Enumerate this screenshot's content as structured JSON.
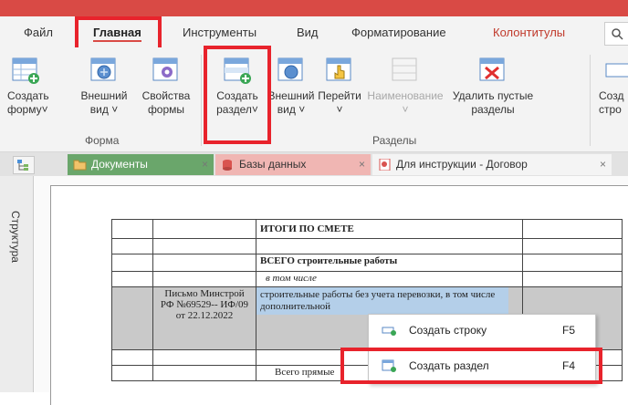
{
  "ribbon_tabs": {
    "file": "Файл",
    "home": "Главная",
    "tools": "Инструменты",
    "view": "Вид",
    "formatting": "Форматирование",
    "headers": "Колонтитулы",
    "search_icon": "search-icon"
  },
  "ribbon": {
    "form_group": {
      "label": "Форма",
      "create_form": [
        "Создать",
        "форму˅"
      ],
      "external_view": [
        "Внешний",
        "вид ˅"
      ],
      "properties": [
        "Свойства",
        "формы"
      ]
    },
    "sections_group": {
      "label": "Разделы",
      "create_section": [
        "Создать",
        "раздел˅"
      ],
      "external_view": [
        "Внешний",
        "вид ˅"
      ],
      "goto": [
        "Перейти",
        "˅"
      ],
      "naming": [
        "Наименование",
        "˅"
      ],
      "delete_empty": [
        "Удалить пустые",
        "разделы"
      ]
    },
    "next_group": {
      "create_row": [
        "Созд",
        "стро"
      ]
    }
  },
  "doc_tabs": {
    "documents": "Документы",
    "databases": "Базы данных",
    "instruction": "Для инструкции - Договор",
    "close": "×"
  },
  "side_panel": {
    "structure": "Структура"
  },
  "sheet": {
    "totals": "ИТОГИ ПО СМЕТЕ",
    "total_construction": "ВСЕГО строительные работы",
    "including": "в том числе",
    "letter": "Письмо Минстрой РФ №69529-- ИФ/09 от 22.12.2022",
    "construction_no_transport": "строительные работы без учета перевозки, в том числе дополнительной",
    "total_direct": "Всего прямые"
  },
  "context_menu": {
    "items": [
      {
        "label": "Создать строку",
        "shortcut": "F5"
      },
      {
        "label": "Создать раздел",
        "shortcut": "F4"
      }
    ]
  },
  "colors": {
    "accent": "#d94a45",
    "highlight": "#e8232c",
    "selection": "#b4cfe9"
  }
}
